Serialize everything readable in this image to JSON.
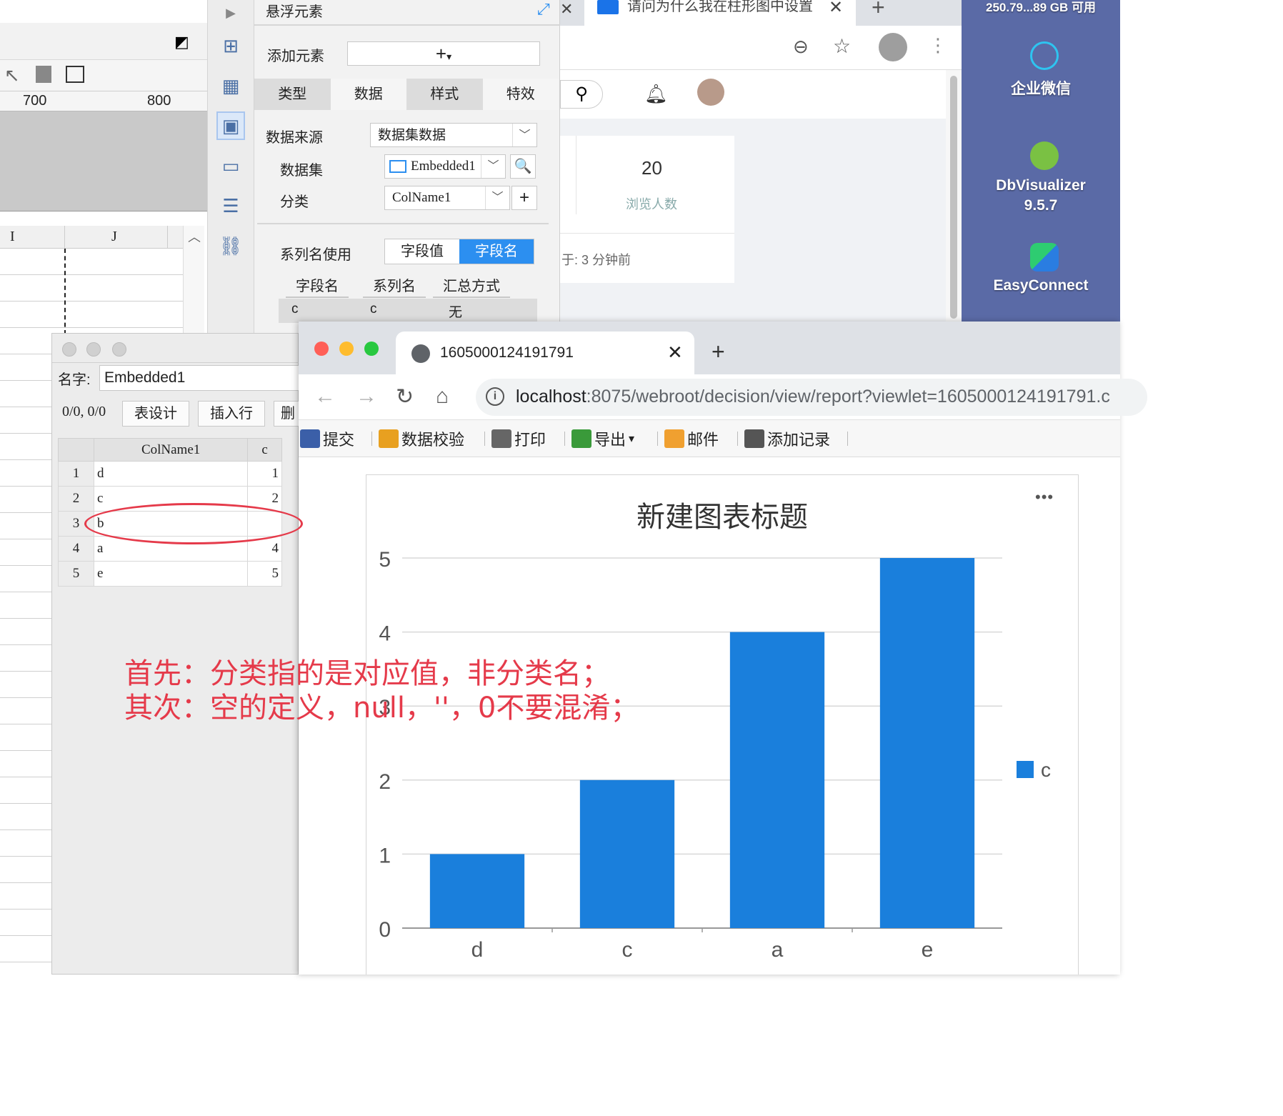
{
  "designer": {
    "ruler_ticks": [
      "700",
      "800"
    ],
    "columns": [
      "I",
      "J"
    ]
  },
  "panel": {
    "title": "悬浮元素",
    "add_element_label": "添加元素",
    "add_element_value": "+",
    "tabs": [
      "类型",
      "数据",
      "样式",
      "特效"
    ],
    "data_source_label": "数据来源",
    "data_source_value": "数据集数据",
    "dataset_label": "数据集",
    "dataset_value": "Embedded1",
    "category_label": "分类",
    "category_value": "ColName1",
    "series_name_label": "系列名使用",
    "series_toggle": [
      "字段值",
      "字段名"
    ],
    "field_headers": [
      "字段名",
      "系列名",
      "汇总方式"
    ],
    "field_row": [
      "c",
      "c",
      "无"
    ]
  },
  "bg_browser": {
    "tab_title": "请问为什么我在柱形图中设置",
    "stat_value": "20",
    "stat_label": "浏览人数",
    "time_text": "于: 3 分钟前"
  },
  "desktop": {
    "disk_text": "250.79...89 GB 可用",
    "icons": [
      {
        "label": "企业微信",
        "icon": "wecom-icon"
      },
      {
        "label": "DbVisualizer\n9.5.7",
        "line1": "DbVisualizer",
        "line2": "9.5.7",
        "icon": "dbvisualizer-icon"
      },
      {
        "label": "EasyConnect",
        "icon": "easyconnect-icon"
      }
    ]
  },
  "dataset_dialog": {
    "name_label": "名字:",
    "name_value": "Embedded1",
    "position": "0/0, 0/0",
    "buttons": [
      "表设计",
      "插入行",
      "删"
    ],
    "columns": [
      "ColName1",
      "c"
    ],
    "rows": [
      {
        "n": "1",
        "name": "d",
        "value": "1"
      },
      {
        "n": "2",
        "name": "c",
        "value": "2"
      },
      {
        "n": "3",
        "name": "b",
        "value": ""
      },
      {
        "n": "4",
        "name": "a",
        "value": "4"
      },
      {
        "n": "5",
        "name": "e",
        "value": "5"
      }
    ]
  },
  "browser": {
    "tab_title": "1605000124191791",
    "url_host": "localhost",
    "url_path": ":8075/webroot/decision/view/report?viewlet=1605000124191791.c",
    "toolbar": [
      {
        "label": "提交",
        "icon": "save-icon",
        "color": "#3b5fa8"
      },
      {
        "label": "数据校验",
        "icon": "check-icon",
        "color": "#e8a020"
      },
      {
        "label": "打印",
        "icon": "print-icon",
        "color": "#666666"
      },
      {
        "label": "导出",
        "icon": "export-icon",
        "color": "#3a9a3a"
      },
      {
        "label": "邮件",
        "icon": "mail-icon",
        "color": "#f0a030"
      },
      {
        "label": "添加记录",
        "icon": "add-record-icon",
        "color": "#555555"
      }
    ],
    "more_label": "•••"
  },
  "annotation": {
    "line1": "首先：分类指的是对应值，非分类名；",
    "line2": "其次：空的定义，null，''，0不要混淆；",
    "color": "#e53a4a"
  },
  "chart_data": {
    "type": "bar",
    "title": "新建图表标题",
    "categories": [
      "d",
      "c",
      "a",
      "e"
    ],
    "series": [
      {
        "name": "c",
        "values": [
          1,
          2,
          4,
          5
        ]
      }
    ],
    "ylim": [
      0,
      5
    ],
    "yticks": [
      0,
      1,
      2,
      3,
      4,
      5
    ],
    "grid": true,
    "legend": "right",
    "bar_color": "#1a7fdc",
    "xlabel": "",
    "ylabel": ""
  }
}
